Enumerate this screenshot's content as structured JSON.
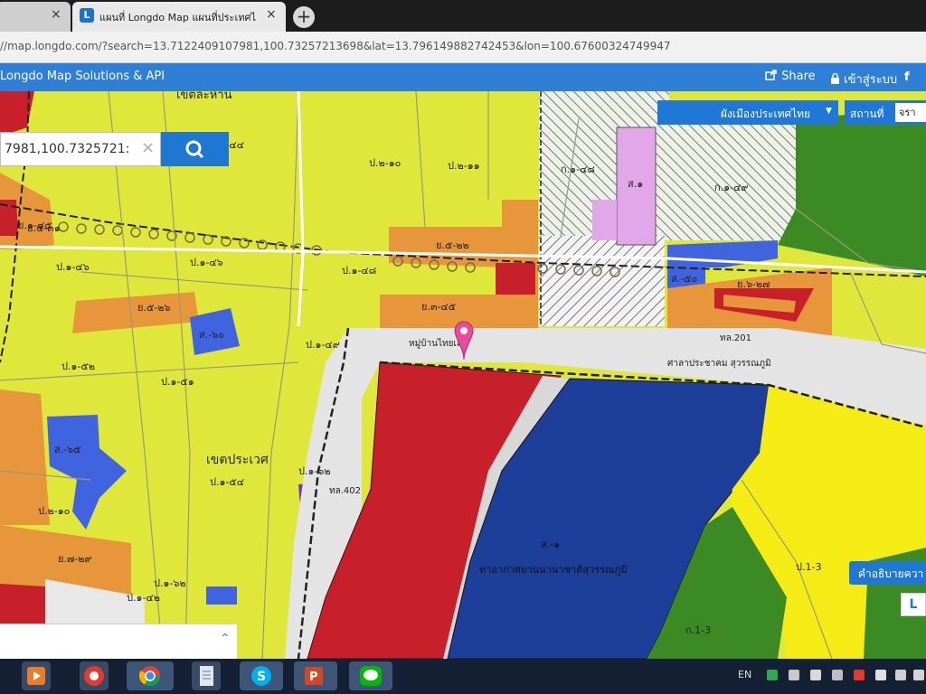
{
  "browser": {
    "tabs": [
      {
        "label": "แผนที่ Longdo Map แผนที่ประเทศไ",
        "close": "×",
        "favicon": "L"
      }
    ],
    "new_tab_symbol": "+",
    "url": "//map.longdo.com/?search=13.7122409107981,100.73257213698&lat=13.796149882742453&lon=100.67600324749947"
  },
  "header": {
    "brand": "Longdo Map Solutions & API",
    "share_label": "Share",
    "login_label": "เข้าสู่ระบบ",
    "facebook_label": "f"
  },
  "search": {
    "value": "7981,100.7325721:",
    "clear_symbol": "×"
  },
  "layer_dropdown": {
    "label": "ผังเมืองประเทศไทย",
    "caret": "▼"
  },
  "station": {
    "label": "สถานที่",
    "value": "จรา"
  },
  "legend_button": {
    "label": "คำอธิบายควา"
  },
  "corner_button": {
    "label": "L"
  },
  "map_labels": {
    "district_1": "เขตละหาน",
    "district_2": "เขตประเวศ",
    "zone_1": "ป.๒-๑๐",
    "zone_2": "ป.๒-๑๑",
    "zone_3": "ป.๑-๔๔",
    "zone_4": "ป.๑-๔๖",
    "zone_5": "ย.๕-๒๒",
    "zone_6": "ย.๕-๒๖",
    "zone_7": "ย.๓-๔๕",
    "zone_8": "ป.๑-๔๘",
    "zone_9": "ย.๕-๓๑",
    "zone_10": "ส.-๖๐",
    "zone_11": "ป.๑-๕๒",
    "zone_12": "ป.๑-๕๑",
    "zone_13": "ป.๑-๔๙",
    "zone_14": "ส.-๖๕",
    "zone_15": "ป.๑-๕๔",
    "zone_16": "ป.๑-๖๒",
    "zone_17": "ย.๗-๒๙",
    "zone_18": "ป.๑-๖๒",
    "zone_19": "ก.๑-๔๘",
    "zone_20": "ก.๑-๔๙",
    "zone_21": "ส.๑",
    "zone_22": "ส.-๕๐",
    "zone_23": "ย.๖-๒๗",
    "zone_24": "ป.๒-๑๐",
    "zone_25": "ป.๑-๔๖",
    "zone_26": "ย.๑-๔๕",
    "zone_27": "ป.๑-๔๒",
    "road_1": "ทล.201",
    "road_2": "ทล.402",
    "place_1": "หมู่บ้านไทยเลค",
    "place_2": "ศาลาประชาคม สุวรรณภูมิ",
    "airport": "ท่าอากาศยานนานาชาติสุวรรณภูมิ",
    "airport_zone": "ส.-๑",
    "zone_east": "ก.1-3",
    "zone_ac": "ป.1-3"
  },
  "taskbar": {
    "lang": "EN"
  },
  "colors": {
    "residential_low": "#dfe83a",
    "residential_mid": "#e8963b",
    "commercial": "#c8202a",
    "government": "#1d3f9a",
    "institution": "#4063e0",
    "religious": "#7a34c8",
    "agriculture": "#3c8a24",
    "rural": "#f4ec14",
    "accent": "#1f78d6"
  }
}
